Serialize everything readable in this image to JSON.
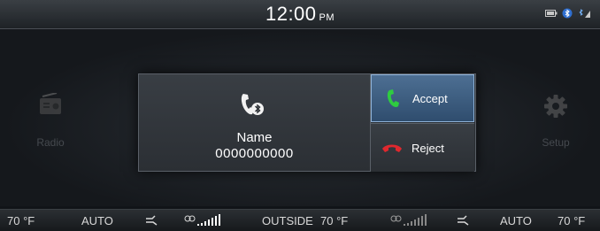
{
  "status_bar": {
    "time": "12:00",
    "ampm": "PM",
    "icons": [
      "battery-icon",
      "bluetooth-icon",
      "signal-icon"
    ]
  },
  "home": {
    "left_app": {
      "label": "Radio",
      "icon": "radio-icon"
    },
    "right_app": {
      "label": "Setup",
      "icon": "gear-icon"
    }
  },
  "incoming_call": {
    "icon": "bluetooth-phone-icon",
    "name": "Name",
    "number": "0000000000",
    "accept_label": "Accept",
    "reject_label": "Reject",
    "accent_color": "#4d6f93",
    "accept_color": "#2ecc40",
    "reject_color": "#e0282e"
  },
  "climate": {
    "left_temp": "70 °F",
    "left_mode": "AUTO",
    "outside_label": "OUTSIDE",
    "outside_temp": "70 °F",
    "right_mode": "AUTO",
    "right_temp": "70 °F"
  }
}
